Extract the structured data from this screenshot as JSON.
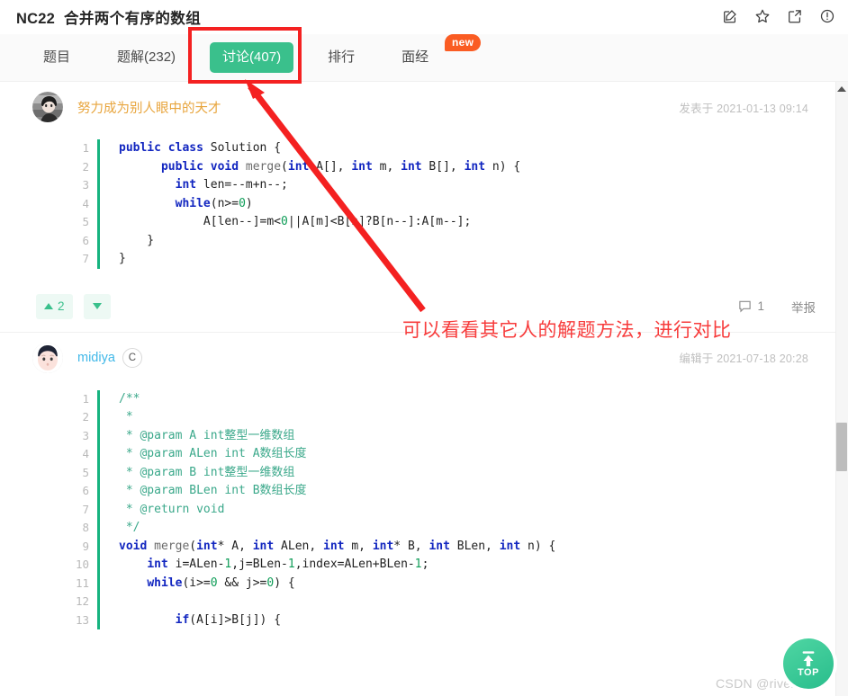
{
  "header": {
    "problem_id": "NC22",
    "problem_title": "合并两个有序的数组",
    "icons": [
      {
        "name": "edit-icon",
        "label": "编辑"
      },
      {
        "name": "star-icon",
        "label": "收藏"
      },
      {
        "name": "share-icon",
        "label": "分享"
      },
      {
        "name": "info-icon",
        "label": "反馈"
      }
    ]
  },
  "tabs": {
    "items": [
      {
        "label": "题目",
        "active": false
      },
      {
        "label": "题解(232)",
        "active": false
      },
      {
        "label": "讨论(407)",
        "active": true
      },
      {
        "label": "排行",
        "active": false
      },
      {
        "label": "面经",
        "active": false
      }
    ],
    "badge": "new"
  },
  "posts": [
    {
      "author": "努力成为别人眼中的天才",
      "author_color": "#e8a53d",
      "tag": null,
      "time_label": "发表于 2021-01-13 09:14",
      "avatar": "anime-avatar",
      "code_lines": [
        {
          "n": "1",
          "html": "<span class=\"kw\">public</span> <span class=\"kw\">class</span> Solution {"
        },
        {
          "n": "2",
          "html": "      <span class=\"kw\">public</span> <span class=\"kw\">void</span> <span class=\"fn\">merge</span>(<span class=\"kw\">int</span> A[], <span class=\"kw\">int</span> m, <span class=\"kw\">int</span> B[], <span class=\"kw\">int</span> n) {"
        },
        {
          "n": "3",
          "html": "        <span class=\"kw\">int</span> len=--m+n--;"
        },
        {
          "n": "4",
          "html": "        <span class=\"kw\">while</span>(n&gt;=<span class=\"num\">0</span>)"
        },
        {
          "n": "5",
          "html": "            A[len--]=m&lt;<span class=\"num\">0</span>||A[m]&lt;B[n]?B[n--]:A[m--];"
        },
        {
          "n": "6",
          "html": "    }"
        },
        {
          "n": "7",
          "html": "}"
        }
      ],
      "votes": "2",
      "comments": "1",
      "report_label": "举报"
    },
    {
      "author": "midiya",
      "author_color": "#41b8e8",
      "tag": "C",
      "time_label": "编辑于 2021-07-18 20:28",
      "avatar": "cartoon-avatar",
      "code_lines": [
        {
          "n": "1",
          "html": "<span class=\"cmt\">/**</span>"
        },
        {
          "n": "2",
          "html": " <span class=\"cmt\">*</span>"
        },
        {
          "n": "3",
          "html": " <span class=\"cmt\">* @param A int整型一维数组</span>"
        },
        {
          "n": "4",
          "html": " <span class=\"cmt\">* @param ALen int A数组长度</span>"
        },
        {
          "n": "5",
          "html": " <span class=\"cmt\">* @param B int整型一维数组</span>"
        },
        {
          "n": "6",
          "html": " <span class=\"cmt\">* @param BLen int B数组长度</span>"
        },
        {
          "n": "7",
          "html": " <span class=\"cmt\">* @return void</span>"
        },
        {
          "n": "8",
          "html": " <span class=\"cmt\">*/</span>"
        },
        {
          "n": "9",
          "html": "<span class=\"kw\">void</span> <span class=\"fn\">merge</span>(<span class=\"kw\">int</span>* A, <span class=\"kw\">int</span> ALen, <span class=\"kw\">int</span> m, <span class=\"kw\">int</span>* B, <span class=\"kw\">int</span> BLen, <span class=\"kw\">int</span> n) {"
        },
        {
          "n": "10",
          "html": "    <span class=\"kw\">int</span> i=ALen-<span class=\"num\">1</span>,j=BLen-<span class=\"num\">1</span>,index=ALen+BLen-<span class=\"num\">1</span>;"
        },
        {
          "n": "11",
          "html": "    <span class=\"kw\">while</span>(i&gt;=<span class=\"num\">0</span> &amp;&amp; j&gt;=<span class=\"num\">0</span>) {"
        },
        {
          "n": "12",
          "html": ""
        },
        {
          "n": "13",
          "html": "        <span class=\"kw\">if</span>(A[i]&gt;B[j]) {"
        }
      ]
    }
  ],
  "annotation": {
    "text": "可以看看其它人的解题方法，进行对比",
    "color": "#f73c3c",
    "highlight_color": "#f42121"
  },
  "floating": {
    "top_label": "TOP"
  },
  "watermark": "CSDN @rivencode"
}
